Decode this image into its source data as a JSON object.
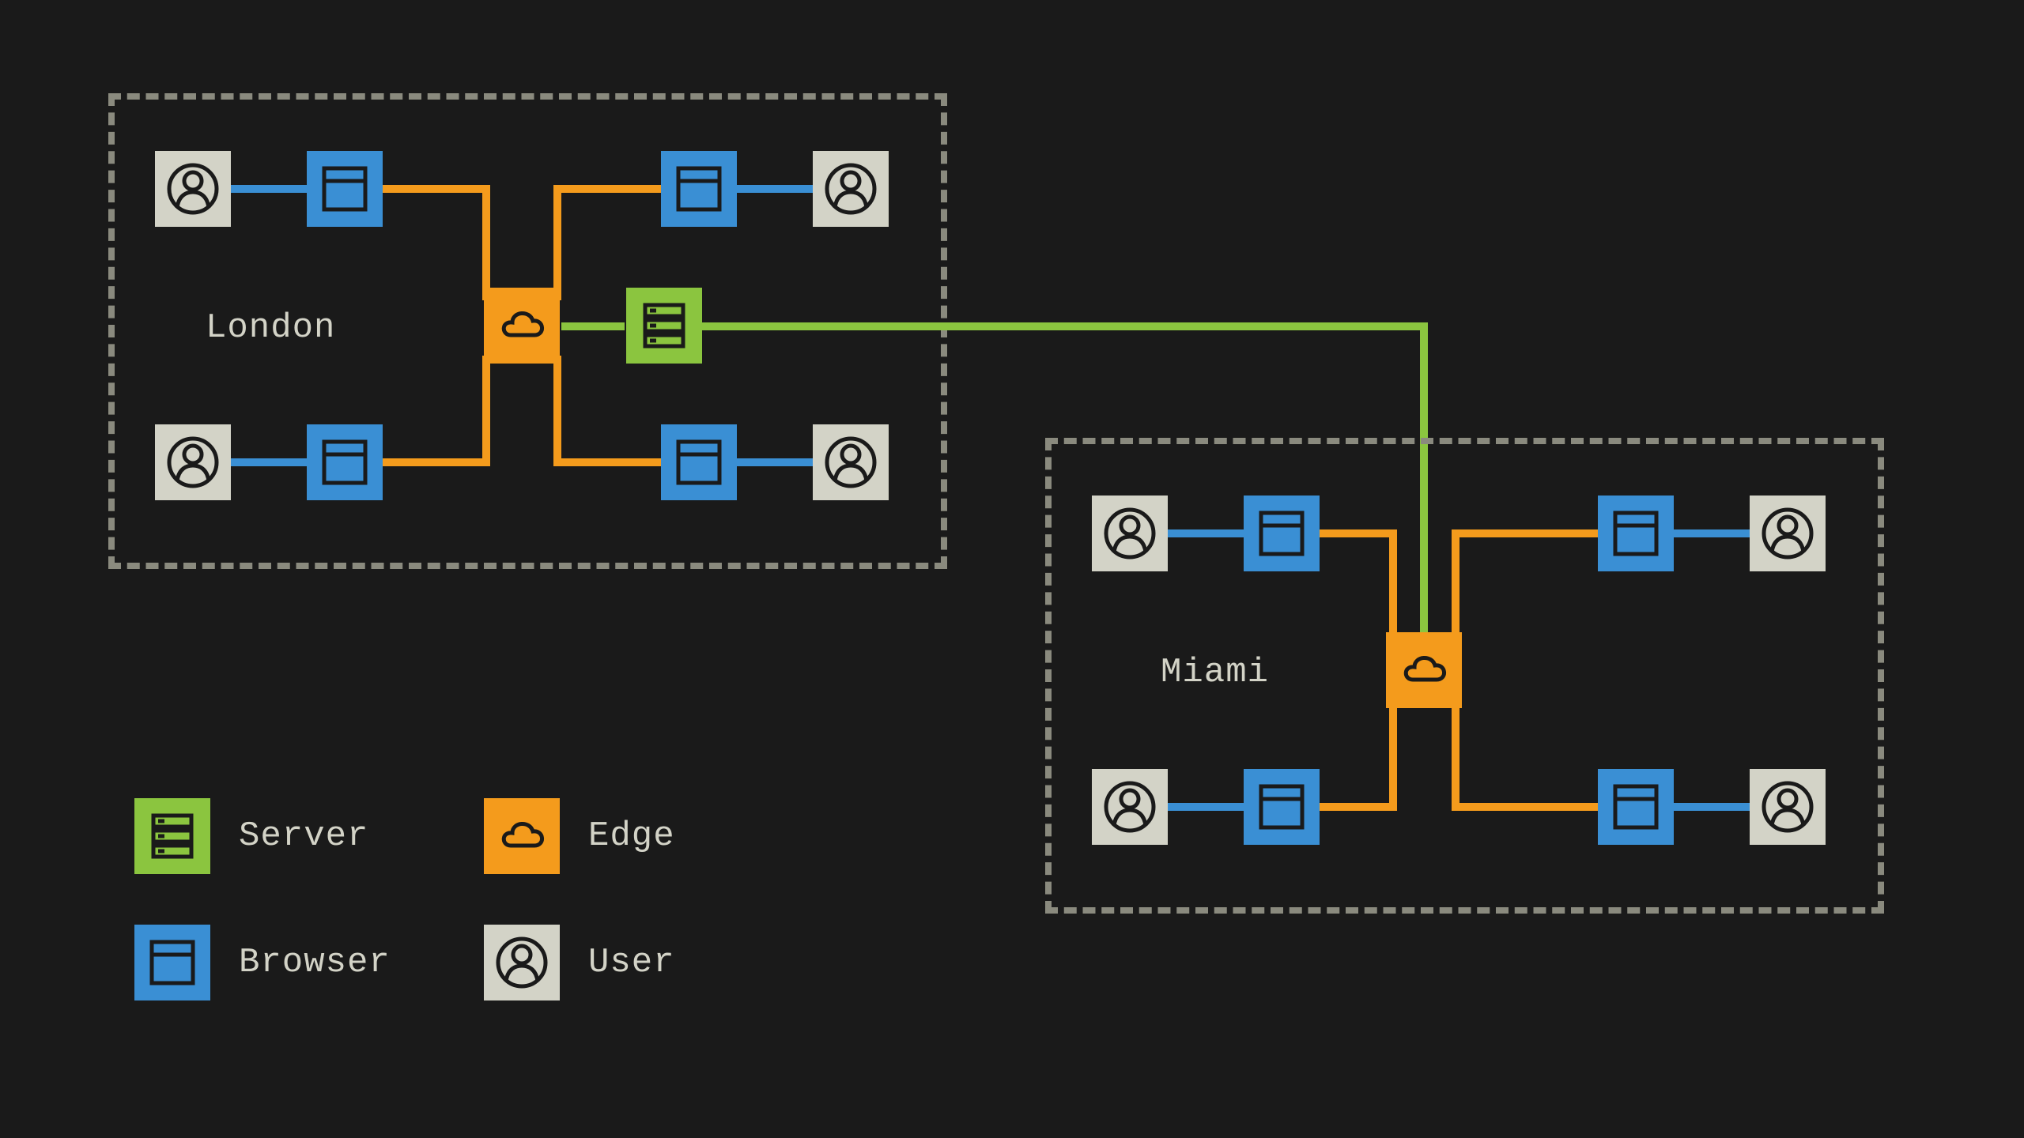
{
  "colors": {
    "bg": "#1a1a1a",
    "dash": "#8a8a7e",
    "user": "#d3d3c7",
    "browser": "#3a8fd4",
    "edge": "#f49b1c",
    "server": "#8bc53f",
    "text": "#d3d3c7"
  },
  "regions": [
    {
      "id": "london",
      "label": "London"
    },
    {
      "id": "miami",
      "label": "Miami"
    }
  ],
  "legend": {
    "server": "Server",
    "edge": "Edge",
    "browser": "Browser",
    "user": "User"
  },
  "diagram": {
    "description": "Two regions (London and Miami). Each region has four User↔Browser pairs feeding into a central Edge node. London also contains a Server node. The two regions' Edge nodes are linked via the Server over a green connection.",
    "node_types": [
      "user",
      "browser",
      "edge",
      "server"
    ],
    "edges": [
      {
        "from": "user",
        "to": "browser",
        "color": "blue"
      },
      {
        "from": "browser",
        "to": "edge",
        "color": "orange"
      },
      {
        "from": "edge",
        "to": "server",
        "color": "green"
      },
      {
        "from": "server-london",
        "to": "edge-miami",
        "color": "green"
      }
    ]
  }
}
